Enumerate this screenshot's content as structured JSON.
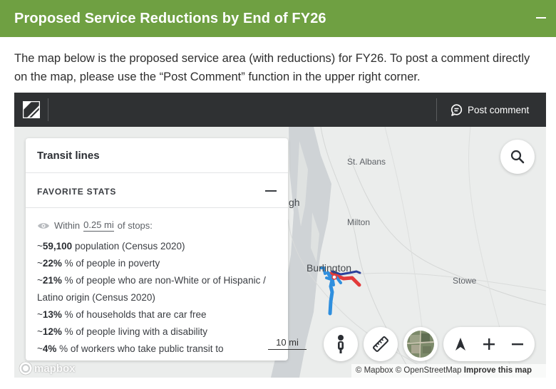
{
  "header": {
    "title": "Proposed Service Reductions by End of FY26"
  },
  "intro": {
    "text": "The map below is the proposed service area (with reductions) for FY26. To post a comment directly on the map, please use the “Post Comment” function in the upper right corner."
  },
  "toolbar": {
    "post_comment": "Post comment"
  },
  "map": {
    "places": {
      "st_albans": "St. Albans",
      "milton": "Milton",
      "burlington": "Burlington",
      "stowe": "Stowe",
      "gh_fragment": "gh"
    },
    "scale_label": "10 mi",
    "mapbox_logo": "mapbox",
    "attribution": {
      "mapbox": "© Mapbox",
      "osm": "© OpenStreetMap",
      "improve": "Improve this map"
    }
  },
  "panel": {
    "title": "Transit lines",
    "favorite_label": "FAVORITE STATS",
    "within_prefix": "Within",
    "within_distance": "0.25 mi",
    "within_suffix": "of stops:",
    "stats": [
      {
        "prefix": "~",
        "value": "59,100",
        "text": " population (Census 2020)"
      },
      {
        "prefix": "~",
        "value": "22%",
        "text": " % of people in poverty"
      },
      {
        "prefix": "~",
        "value": "21%",
        "text": " % of people who are non-White or of Hispanic / Latino origin (Census 2020)"
      },
      {
        "prefix": "~",
        "value": "13%",
        "text": " % of households that are car free"
      },
      {
        "prefix": "~",
        "value": "12%",
        "text": " % of people living with a disability"
      },
      {
        "prefix": "~",
        "value": "4%",
        "text": " % of workers who take public transit to"
      }
    ]
  },
  "colors": {
    "header_green": "#6fa042",
    "toolbar_dark": "#2f3133",
    "route_blue": "#2f8fde",
    "route_red": "#e23a3a",
    "route_navy": "#2a3f9a"
  },
  "icons": {
    "logo": "remix-logo-icon",
    "comment": "comment-bubble-icon",
    "search": "search-icon",
    "street_view": "pegman-icon",
    "measure": "ruler-icon",
    "satellite": "satellite-thumbnail-icon",
    "north": "compass-arrow-icon",
    "zoom_in": "plus-icon",
    "zoom_out": "minus-icon",
    "visibility": "eye-icon"
  }
}
